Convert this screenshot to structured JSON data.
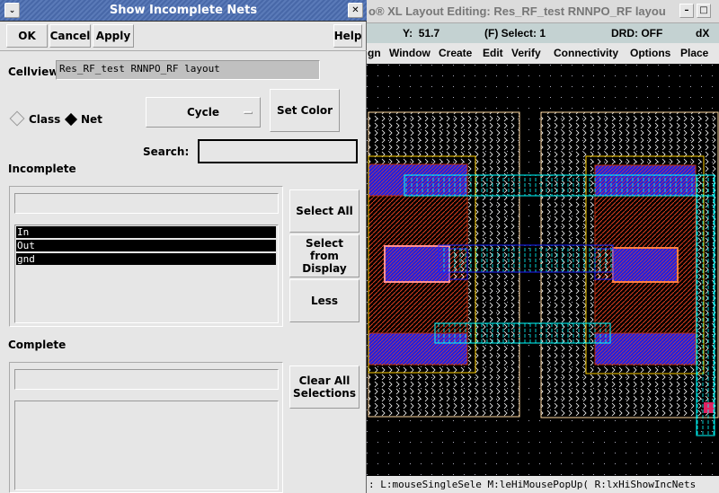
{
  "dialog": {
    "title": "Show Incomplete Nets",
    "ok": "OK",
    "cancel": "Cancel",
    "apply": "Apply",
    "help": "Help",
    "cellview_label": "Cellview",
    "cellview_value": "Res_RF_test RNNPO_RF layout",
    "radio_class": "Class",
    "radio_net": "Net",
    "selected_radio": "Net",
    "cycle": "Cycle",
    "set_color": "Set Color",
    "search_label": "Search:",
    "search_value": "",
    "incomplete_label": "Incomplete",
    "incomplete_items": [
      "In",
      "Out",
      "gnd"
    ],
    "select_all": "Select All",
    "select_from_display": "Select from Display",
    "less": "Less",
    "complete_label": "Complete",
    "clear_all": "Clear All Selections"
  },
  "layout": {
    "title": "o® XL Layout Editing: Res_RF_test RNNPO_RF layou",
    "status": {
      "y": "Y:  51.7",
      "select": "(F) Select: 1",
      "drd": "DRD: OFF",
      "dx": "dX"
    },
    "menu": [
      "gn",
      "Window",
      "Create",
      "Edit",
      "Verify",
      "Connectivity",
      "Options",
      "Place"
    ],
    "mouse_status": ": L:mouseSingleSele M:leHiMousePopUp( R:lxHiShowIncNets"
  },
  "colors": {
    "diffusion": "#2020e0",
    "poly": "#c03010",
    "metal": "#00ffff",
    "boundary": "#ffd8a0",
    "well": "#ffd000"
  }
}
